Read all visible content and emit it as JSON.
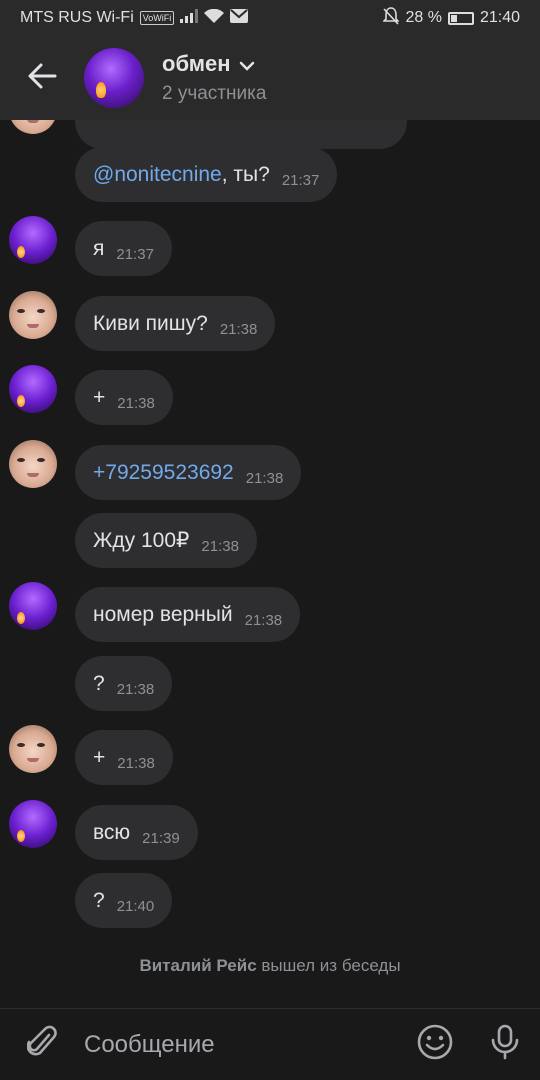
{
  "status_bar": {
    "carrier": "MTS RUS Wi-Fi",
    "volte": "VoWiFi",
    "battery": "28 %",
    "time": "21:40"
  },
  "header": {
    "title": "обмен",
    "subtitle": "2 участника"
  },
  "messages": [
    {
      "avatar": "none",
      "mention": "@nonitecnine",
      "text": ", ты?",
      "time": "21:37"
    },
    {
      "avatar": "purple",
      "text": "я",
      "time": "21:37"
    },
    {
      "avatar": "face",
      "text": "Киви пишу?",
      "time": "21:38"
    },
    {
      "avatar": "purple",
      "text": "+",
      "time": "21:38"
    },
    {
      "avatar": "face",
      "text": "+79259523692",
      "link": true,
      "time": "21:38"
    },
    {
      "avatar": "none",
      "text": "Жду 100₽",
      "time": "21:38"
    },
    {
      "avatar": "purple",
      "text": "номер верный",
      "time": "21:38"
    },
    {
      "avatar": "none",
      "text": "?",
      "time": "21:38"
    },
    {
      "avatar": "face",
      "text": "+",
      "time": "21:38"
    },
    {
      "avatar": "purple",
      "text": "всю",
      "time": "21:39"
    },
    {
      "avatar": "none",
      "text": "?",
      "time": "21:40"
    }
  ],
  "system_message": {
    "name": "Виталий Рейс",
    "action": "вышел из беседы"
  },
  "composer": {
    "placeholder": "Сообщение"
  },
  "colors": {
    "background": "#19191a",
    "bubble": "#2e2e31",
    "link": "#71aaeb",
    "secondary_text": "#8d9095"
  }
}
